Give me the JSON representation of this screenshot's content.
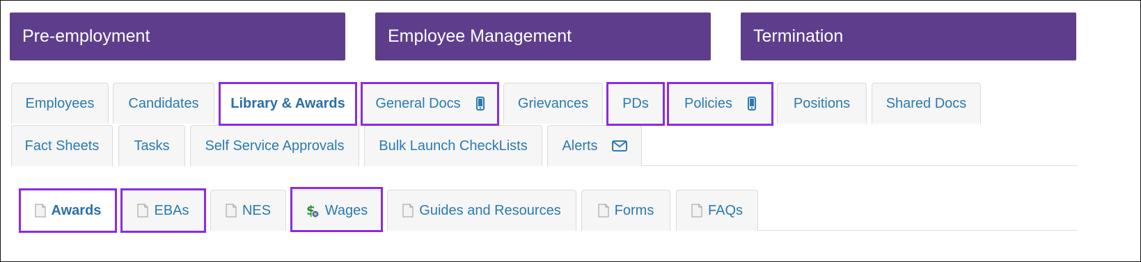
{
  "sections": [
    {
      "label": "Pre-employment"
    },
    {
      "label": "Employee Management"
    },
    {
      "label": "Termination"
    }
  ],
  "primary_tabs_row1": [
    {
      "label": "Employees"
    },
    {
      "label": "Candidates"
    },
    {
      "label": "Library & Awards",
      "active": true
    },
    {
      "label": "General Docs",
      "icon": "mobile-phone-icon"
    },
    {
      "label": "Grievances"
    },
    {
      "label": "PDs"
    },
    {
      "label": "Policies",
      "icon": "mobile-phone-icon"
    },
    {
      "label": "Positions"
    },
    {
      "label": "Shared Docs"
    }
  ],
  "primary_tabs_row2": [
    {
      "label": "Fact Sheets"
    },
    {
      "label": "Tasks"
    },
    {
      "label": "Self Service Approvals"
    },
    {
      "label": "Bulk Launch CheckLists"
    },
    {
      "label": "Alerts",
      "icon": "envelope-icon"
    }
  ],
  "sub_tabs": [
    {
      "label": "Awards",
      "icon": "document-icon",
      "active": true
    },
    {
      "label": "EBAs",
      "icon": "document-icon"
    },
    {
      "label": "NES",
      "icon": "document-icon"
    },
    {
      "label": "Wages",
      "icon": "dollar-coin-icon"
    },
    {
      "label": "Guides and Resources",
      "icon": "document-icon"
    },
    {
      "label": "Forms",
      "icon": "document-icon"
    },
    {
      "label": "FAQs",
      "icon": "document-icon"
    }
  ],
  "colors": {
    "section_band": "#5e3e8c",
    "tab_text": "#2a7ab0",
    "highlight_outline": "#8a2be2"
  }
}
